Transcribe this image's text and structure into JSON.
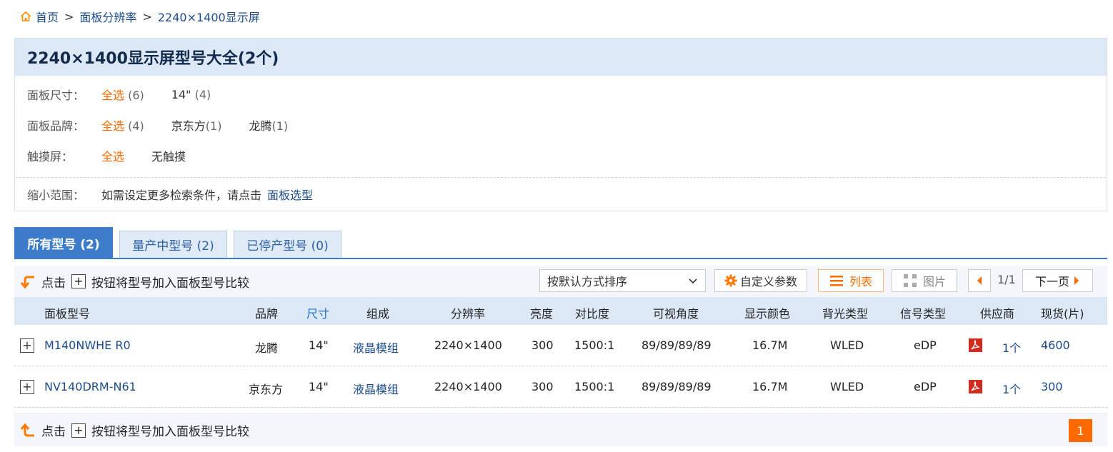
{
  "breadcrumb": {
    "home": "首页",
    "sep": ">",
    "level1": "面板分辨率",
    "level2": "2240×1400显示屏"
  },
  "filter": {
    "title": "2240×1400显示屏型号大全(2个)",
    "size": {
      "label": "面板尺寸：",
      "all": "全选",
      "all_count": "(6)",
      "opt1": "14\"",
      "opt1_count": "(4)"
    },
    "brand": {
      "label": "面板品牌：",
      "all": "全选",
      "all_count": "(4)",
      "opt1": "京东方",
      "opt1_count": "(1)",
      "opt2": "龙腾",
      "opt2_count": "(1)"
    },
    "touch": {
      "label": "触摸屏：",
      "all": "全选",
      "opt1": "无触摸"
    },
    "narrow": {
      "label": "缩小范围：",
      "text": "如需设定更多检索条件，请点击",
      "link": "面板选型"
    }
  },
  "tabs": [
    {
      "label": "所有型号 (2)"
    },
    {
      "label": "量产中型号 (2)"
    },
    {
      "label": "已停产型号 (0)"
    }
  ],
  "toolbar": {
    "compare_click": "点击",
    "compare_plus": "+",
    "compare_text": "按钮将型号加入面板型号比较",
    "sort_value": "按默认方式排序",
    "custom": "自定义参数",
    "list": "列表",
    "picture": "图片",
    "page_info": "1/1",
    "next": "下一页"
  },
  "table": {
    "headers": [
      "面板型号",
      "品牌",
      "尺寸",
      "组成",
      "分辨率",
      "亮度",
      "对比度",
      "可视角度",
      "显示颜色",
      "背光类型",
      "信号类型",
      "供应商",
      "现货(片)"
    ],
    "rows": [
      {
        "model": "M140NWHE R0",
        "brand": "龙腾",
        "size": "14\"",
        "comp": "液晶模组",
        "res": "2240×1400",
        "bright": "300",
        "contrast": "1500:1",
        "angle": "89/89/89/89",
        "color": "16.7M",
        "backlight": "WLED",
        "signal": "eDP",
        "suppliers": "1个",
        "stock": "4600"
      },
      {
        "model": "NV140DRM-N61",
        "brand": "京东方",
        "size": "14\"",
        "comp": "液晶模组",
        "res": "2240×1400",
        "bright": "300",
        "contrast": "1500:1",
        "angle": "89/89/89/89",
        "color": "16.7M",
        "backlight": "WLED",
        "signal": "eDP",
        "suppliers": "1个",
        "stock": "300"
      }
    ]
  },
  "footer": {
    "page": "1"
  },
  "colors": {
    "accent": "#ff6a00",
    "link": "#1a4c8b",
    "tab_active": "#3d7ccb",
    "header_bg": "#dce8f5"
  }
}
